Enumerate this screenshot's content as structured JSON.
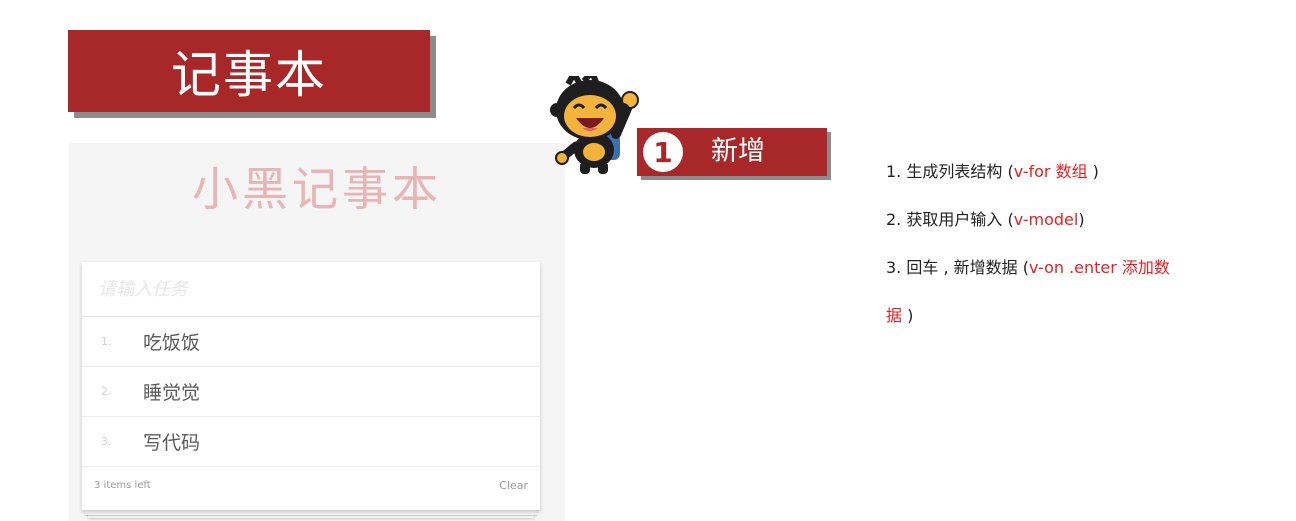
{
  "banner": {
    "title": "记事本"
  },
  "app": {
    "title": "小黑记事本",
    "input": {
      "placeholder": "请输入任务",
      "value": ""
    },
    "todos": [
      {
        "index": "1.",
        "text": "吃饭饭"
      },
      {
        "index": "2.",
        "text": "睡觉觉"
      },
      {
        "index": "3.",
        "text": "写代码"
      }
    ],
    "footer": {
      "count_text": "3 items left",
      "clear_label": "Clear"
    }
  },
  "step": {
    "number": "1",
    "label": "新增"
  },
  "instructions": {
    "item1": {
      "prefix": "1.  生成列表结构 (",
      "code": "v-for  数组",
      "suffix": " )"
    },
    "item2": {
      "prefix": "2.  获取用户输入 (",
      "code": "v-model",
      "suffix": ")"
    },
    "item3": {
      "prefix": "3.  回车 , 新增数据 (",
      "code": "v-on .enter  添加数",
      "suffix": ""
    },
    "item3_cont": {
      "code": "据",
      "suffix": " )"
    }
  },
  "colors": {
    "brand_red": "#a8282a",
    "highlight_red": "#e82020",
    "title_pink": "#e8b4b4"
  }
}
